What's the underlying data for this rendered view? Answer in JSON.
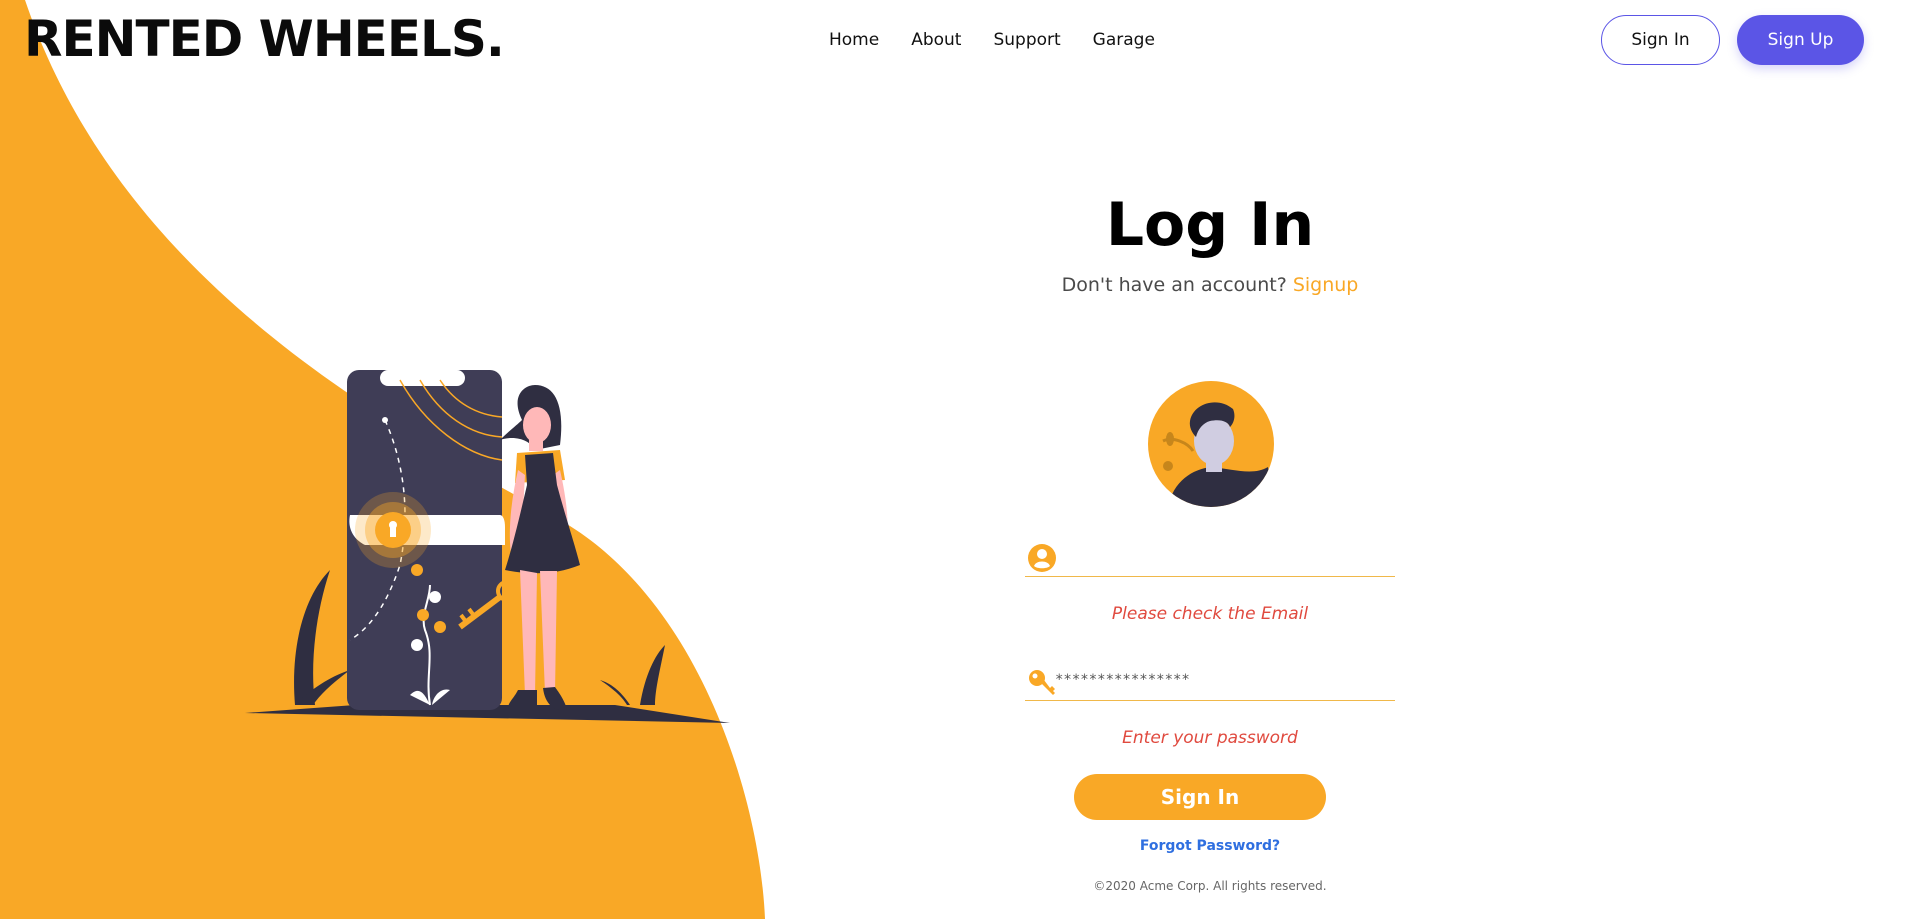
{
  "brand": {
    "title": "RENTED WHEELS."
  },
  "nav": {
    "items": [
      "Home",
      "About",
      "Support",
      "Garage"
    ]
  },
  "header": {
    "sign_in_label": "Sign In",
    "sign_up_label": "Sign Up"
  },
  "login": {
    "title": "Log In",
    "no_account_text": "Don't have an account?",
    "signup_link": "Signup",
    "email": {
      "value": "",
      "placeholder": "",
      "error": "Please check the Email"
    },
    "password": {
      "value": "****************",
      "error": "Enter your password"
    },
    "submit_label": "Sign In",
    "forgot_label": "Forgot Password?"
  },
  "footer": {
    "copyright": "©2020 Acme Corp. All rights reserved."
  },
  "colors": {
    "accent": "#f9a826",
    "primary": "#5b55e6",
    "error": "#e04a3f",
    "link": "#2f6fe0"
  },
  "icons": {
    "email": "user-circle-icon",
    "password": "key-icon"
  }
}
